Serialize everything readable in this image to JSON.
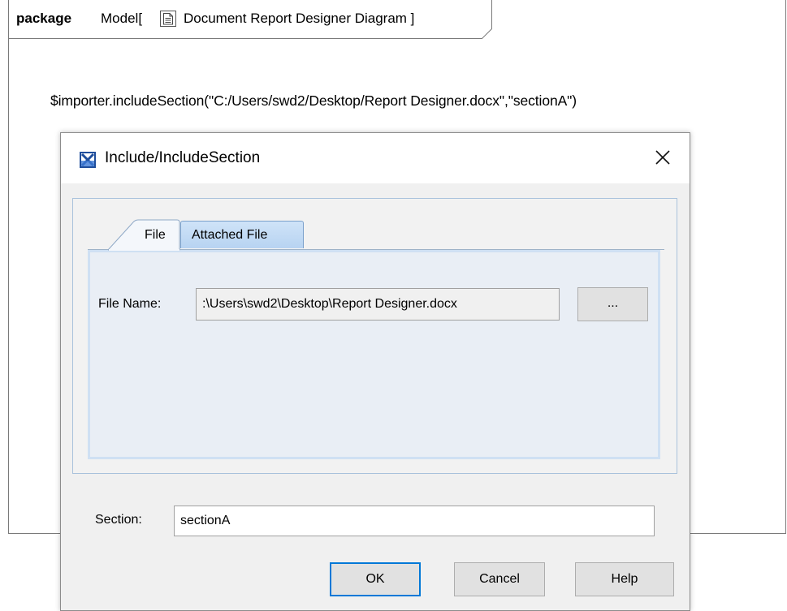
{
  "diagram": {
    "keyword": "package",
    "name": "Model",
    "title": "Document Report Designer Diagram ]",
    "icon": "diagram-document-icon",
    "importer_text": "$importer.includeSection(\"C:/Users/swd2/Desktop/Report Designer.docx\",\"sectionA\")"
  },
  "dialog": {
    "title": "Include/IncludeSection",
    "icon": "app-icon",
    "close_icon": "close-icon",
    "tabs": [
      {
        "label": "File",
        "active": true
      },
      {
        "label": "Attached File",
        "active": false
      }
    ],
    "file_name_label": "File Name:",
    "file_name_value": ":\\Users\\swd2\\Desktop\\Report Designer.docx",
    "browse_label": "...",
    "section_label": "Section:",
    "section_value": "sectionA",
    "buttons": {
      "ok": "OK",
      "cancel": "Cancel",
      "help": "Help"
    }
  },
  "colors": {
    "accent": "#0078d7",
    "tab_active_bg": "#cfe3f8",
    "panel_border": "#a9c2dc"
  }
}
